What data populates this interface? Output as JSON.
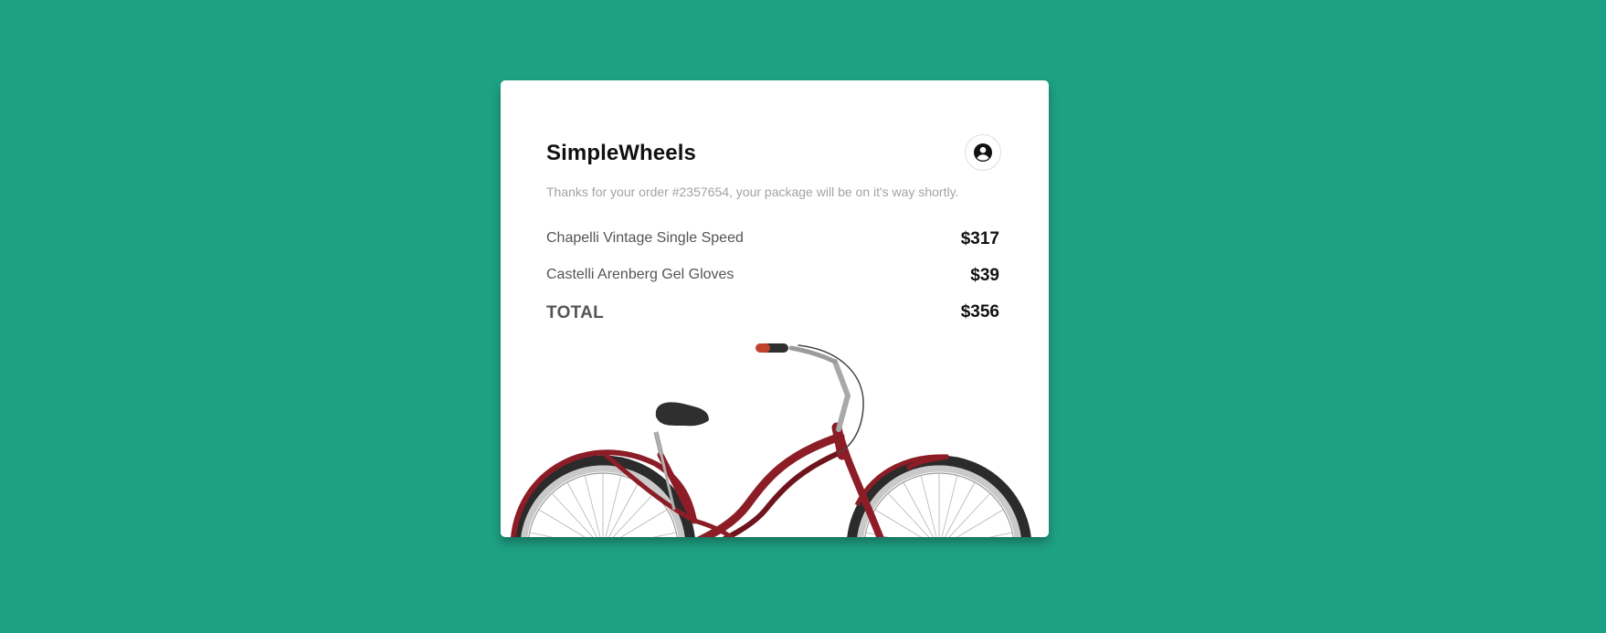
{
  "brand": {
    "name": "SimpleWheels"
  },
  "account_button": {
    "icon": "account-circle-icon"
  },
  "order": {
    "message": "Thanks for your order #2357654, your package will be on it's way shortly.",
    "items": [
      {
        "name": "Chapelli Vintage Single Speed",
        "price": "$317"
      },
      {
        "name": "Castelli Arenberg Gel Gloves",
        "price": "$39"
      }
    ],
    "total_label": "TOTAL",
    "total_value": "$356"
  },
  "image": {
    "subject": "bicycle-image"
  },
  "colors": {
    "background": "#1ea083",
    "card": "#ffffff",
    "frame": "#8c1d26",
    "muted_text": "#a3a3a3"
  }
}
